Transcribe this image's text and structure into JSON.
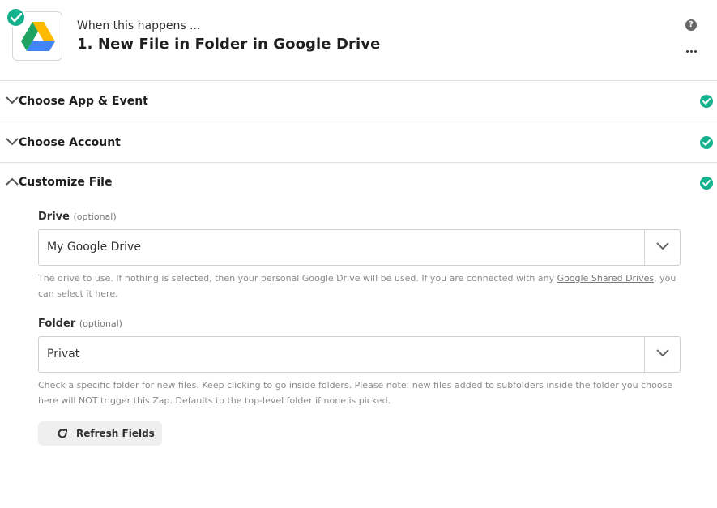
{
  "header": {
    "trigger_label": "When this happens ...",
    "trigger_title": "1. New File in Folder in Google Drive",
    "help_icon": "?",
    "app_icon": "google-drive-icon",
    "status": "complete"
  },
  "sections": [
    {
      "title": "Choose App & Event",
      "expanded": false,
      "status": "complete"
    },
    {
      "title": "Choose Account",
      "expanded": false,
      "status": "complete"
    },
    {
      "title": "Customize File",
      "expanded": true,
      "status": "complete"
    }
  ],
  "fields": {
    "drive": {
      "label": "Drive",
      "optional": "(optional)",
      "value": "My Google Drive",
      "help_before": "The drive to use. If nothing is selected, then your personal Google Drive will be used. If you are connected with any ",
      "help_link": "Google Shared Drives",
      "help_after": ", you can select it here."
    },
    "folder": {
      "label": "Folder",
      "optional": "(optional)",
      "value": "Privat",
      "help": "Check a specific folder for new files. Keep clicking to go inside folders. Please note: new files added to subfolders inside the folder you choose here will NOT trigger this Zap. Defaults to the top-level folder if none is picked."
    }
  },
  "refresh_button": {
    "label": "Refresh Fields"
  },
  "colors": {
    "success": "#13b28d",
    "drive_green": "#1ea362",
    "drive_yellow": "#ffba00",
    "drive_blue": "#4285f4"
  }
}
